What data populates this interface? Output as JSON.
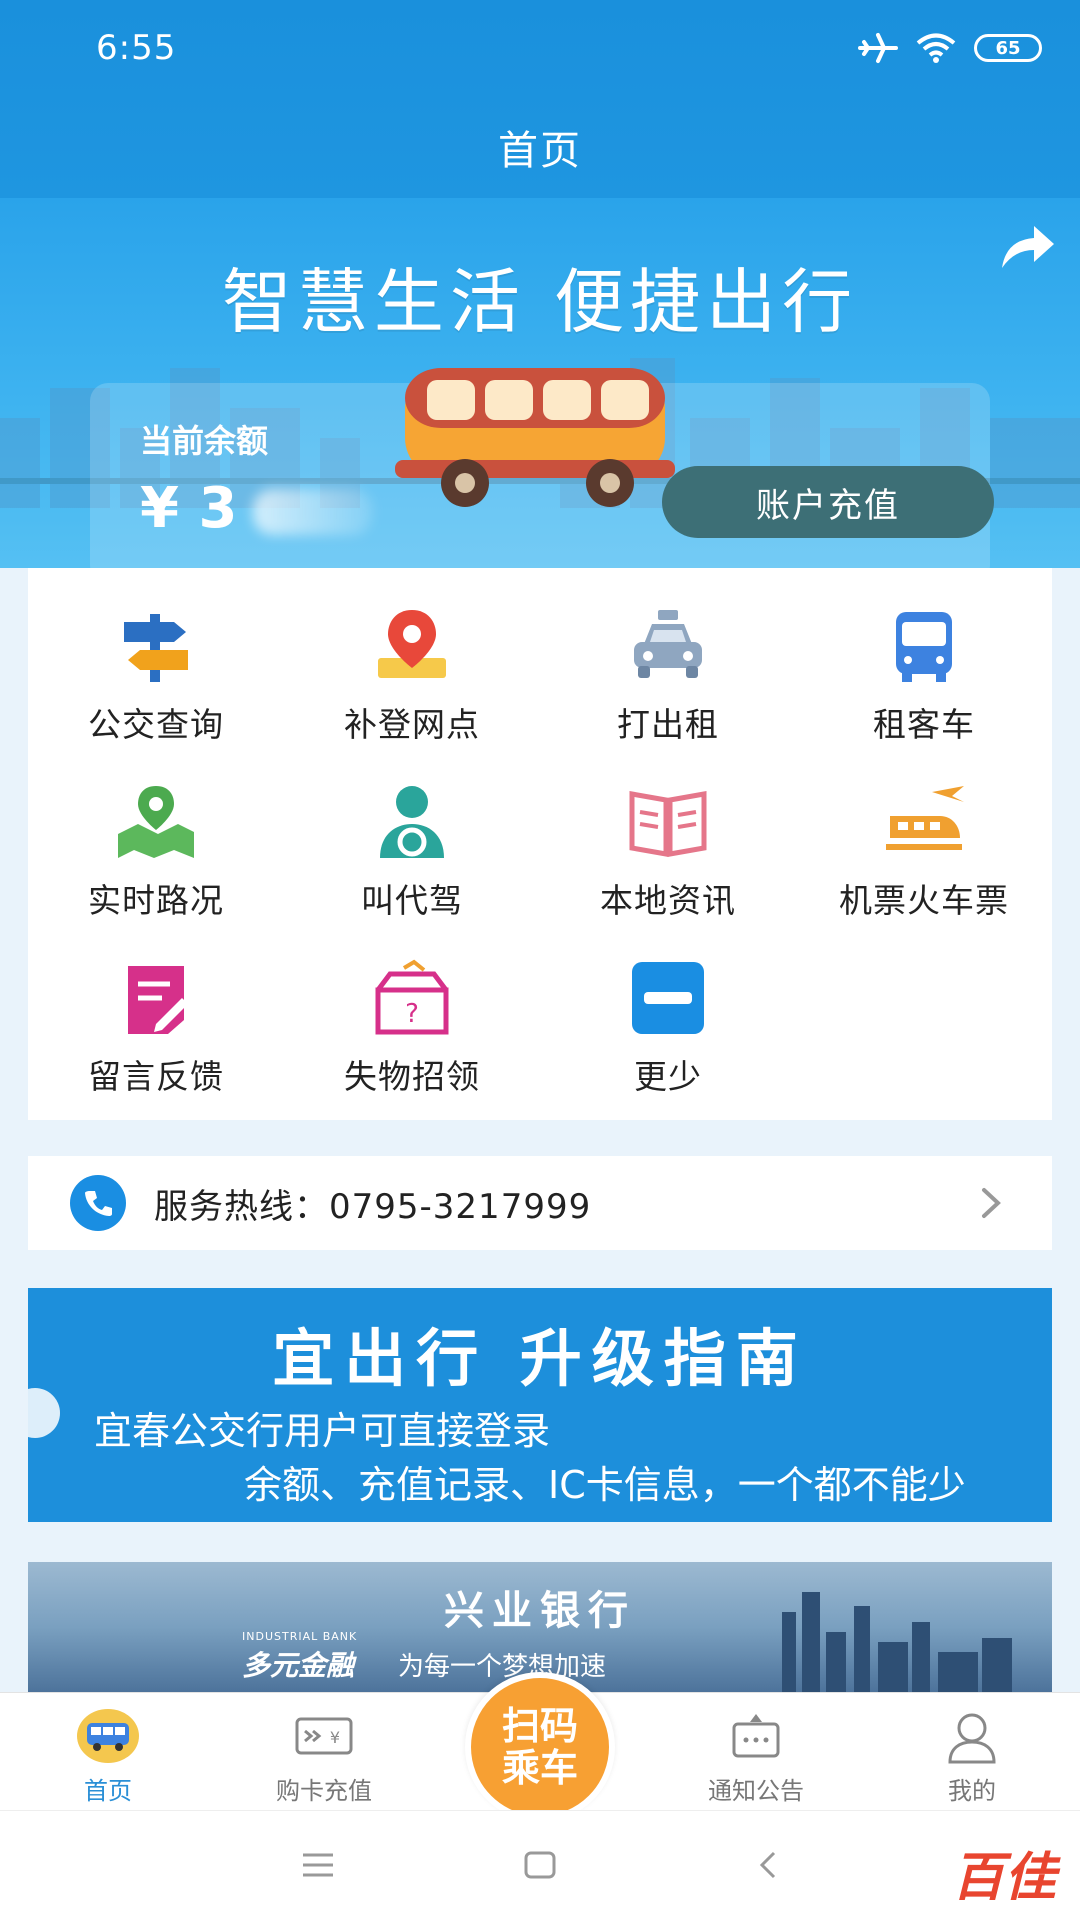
{
  "status_bar": {
    "time": "6:55",
    "battery": "65",
    "icons": [
      "airplane-icon",
      "wifi-icon",
      "battery-icon"
    ]
  },
  "header": {
    "title": "首页"
  },
  "hero": {
    "slogan": "智慧生活  便捷出行",
    "balance_label": "当前余额",
    "balance_value": "¥ 3",
    "recharge_button": "账户充值",
    "share_icon": "share-icon"
  },
  "menu": {
    "items": [
      {
        "label": "公交查询",
        "icon": "signpost-icon"
      },
      {
        "label": "补登网点",
        "icon": "map-pin-icon"
      },
      {
        "label": "打出租",
        "icon": "taxi-icon"
      },
      {
        "label": "租客车",
        "icon": "bus-icon"
      },
      {
        "label": "实时路况",
        "icon": "map-icon"
      },
      {
        "label": "叫代驾",
        "icon": "driver-icon"
      },
      {
        "label": "本地资讯",
        "icon": "book-icon"
      },
      {
        "label": "机票火车票",
        "icon": "plane-train-icon"
      },
      {
        "label": "留言反馈",
        "icon": "note-edit-icon"
      },
      {
        "label": "失物招领",
        "icon": "lost-found-icon"
      },
      {
        "label": "更少",
        "icon": "minus-icon"
      }
    ]
  },
  "hotline": {
    "text": "服务热线：0795-3217999"
  },
  "promo": {
    "title": "宜出行    升级指南",
    "line1": "宜春公交行用户可直接登录",
    "line2": "余额、充值记录、IC卡信息，一个都不能少"
  },
  "bank_banner": {
    "title": "兴业银行",
    "en": "INDUSTRIAL BANK",
    "slogan_bold": "多元金融",
    "slogan": "为每一个梦想加速"
  },
  "tabbar": {
    "tabs": [
      {
        "label": "首页",
        "icon": "home-bus-icon",
        "active": true
      },
      {
        "label": "购卡充值",
        "icon": "card-recharge-icon",
        "active": false
      },
      {
        "label": "通知公告",
        "icon": "notice-icon",
        "active": false
      },
      {
        "label": "我的",
        "icon": "user-icon",
        "active": false
      }
    ],
    "scan_line1": "扫码",
    "scan_line2": "乘车"
  },
  "watermark": "百佳",
  "colors": {
    "primary": "#1a90dc",
    "accent": "#f7a033",
    "recharge_button": "#3d6f76"
  }
}
